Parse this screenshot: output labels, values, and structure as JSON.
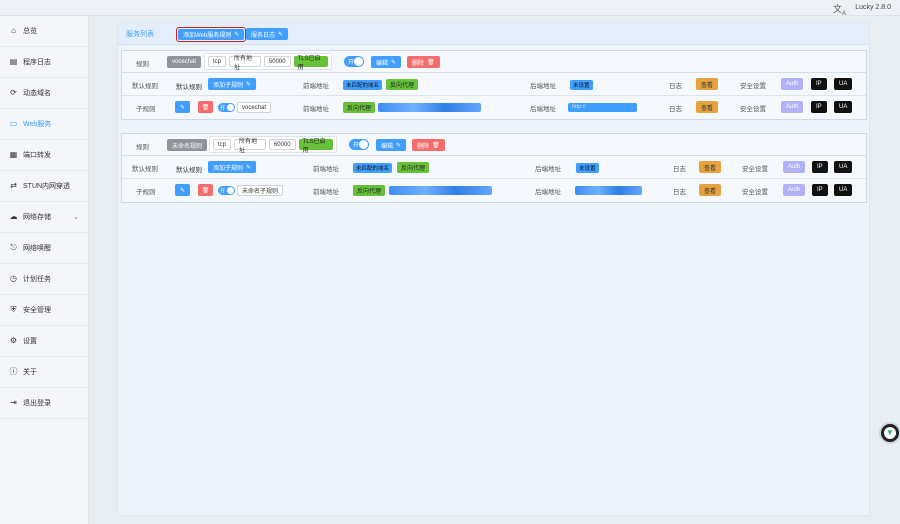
{
  "app": {
    "translate_icon": "translate-icon",
    "version": "Lucky 2.8.0"
  },
  "sidebar": {
    "items": [
      {
        "label": "总览",
        "icon": "home-icon"
      },
      {
        "label": "程序日志",
        "icon": "log-icon"
      },
      {
        "label": "动态域名",
        "icon": "refresh-icon"
      },
      {
        "label": "Web服务",
        "icon": "folder-icon",
        "active": true
      },
      {
        "label": "端口转发",
        "icon": "port-icon"
      },
      {
        "label": "STUN内网穿透",
        "icon": "stun-icon"
      },
      {
        "label": "网络存储",
        "icon": "cloud-icon",
        "expandable": true
      },
      {
        "label": "网络唤醒",
        "icon": "bell-icon"
      },
      {
        "label": "计划任务",
        "icon": "clock-icon"
      },
      {
        "label": "安全管理",
        "icon": "shield-icon"
      },
      {
        "label": "设置",
        "icon": "gear-icon"
      },
      {
        "label": "关于",
        "icon": "info-icon"
      },
      {
        "label": "退出登录",
        "icon": "logout-icon"
      }
    ]
  },
  "tabs": {
    "list_label": "服务列表",
    "add_label": "添加Web服务规则",
    "log_label": "服务日志"
  },
  "common": {
    "rule_label": "规则",
    "default_rule_label": "默认规则",
    "sub_rule_label": "子规则",
    "add_sub_rule": "添加子规则",
    "frontend_label": "前端地址",
    "backend_label": "后端地址",
    "log_label": "日志",
    "view_label": "查看",
    "security_label": "安全设置",
    "auth": "Auth",
    "ip": "IP",
    "ua": "UA",
    "edit": "编辑",
    "delete": "删除",
    "on": "开",
    "tls": "TLS已启用",
    "unmatched_domain": "未匹配的域名",
    "reverse_proxy": "反向代理",
    "not_set": "未设置"
  },
  "rules": [
    {
      "name": "vocechat",
      "protocol": "tcp",
      "address": "所有地址",
      "port": "50000",
      "sub_rule_name": "vocechat",
      "backend_prefix": "http://"
    },
    {
      "name": "未命名规则",
      "protocol": "tcp",
      "address": "所有地址",
      "port": "60000",
      "sub_rule_name": "未命名子规则",
      "backend_prefix": ""
    }
  ],
  "colors": {
    "primary": "#409eff",
    "danger": "#f56c6c",
    "success": "#67c23a",
    "warning": "#e6a23c"
  }
}
